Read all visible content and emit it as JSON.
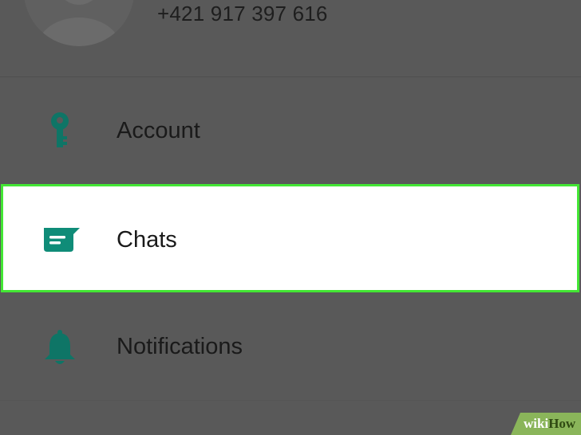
{
  "profile": {
    "phone": "+421 917 397 616"
  },
  "menu": {
    "items": [
      {
        "id": "account",
        "label": "Account",
        "icon": "key-icon"
      },
      {
        "id": "chats",
        "label": "Chats",
        "icon": "chat-icon",
        "highlighted": true
      },
      {
        "id": "notifications",
        "label": "Notifications",
        "icon": "bell-icon"
      }
    ]
  },
  "colors": {
    "background": "#595959",
    "icon_teal": "#0f8c78",
    "highlight_border": "#43e634",
    "highlight_bg": "#ffffff"
  },
  "watermark": {
    "prefix": "wiki",
    "suffix": "How"
  }
}
